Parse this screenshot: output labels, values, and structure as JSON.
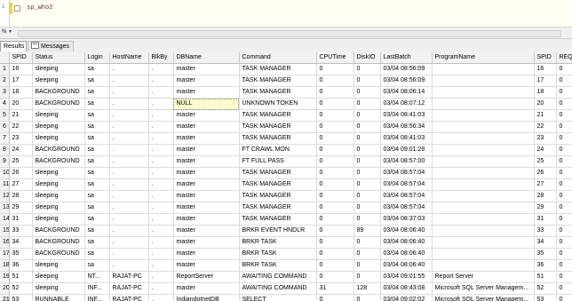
{
  "editor": {
    "line_number": "1",
    "code": "sp_who2"
  },
  "zoom": {
    "value": "%"
  },
  "tabs": [
    {
      "label": "Results"
    },
    {
      "label": "Messages"
    }
  ],
  "grid": {
    "columns": [
      "",
      "SPID",
      "Status",
      "Login",
      "HostName",
      "BlkBy",
      "DBName",
      "Command",
      "CPUTime",
      "DiskIO",
      "LastBatch",
      "ProgramName",
      "SPID",
      "REQ"
    ],
    "rows": [
      [
        "1",
        "16",
        "sleeping",
        "sa",
        ".",
        ".",
        "master",
        "TASK MANAGER",
        "0",
        "0",
        "03/04 08:56:09",
        "",
        "16",
        "0"
      ],
      [
        "2",
        "17",
        "sleeping",
        "sa",
        ".",
        ".",
        "master",
        "TASK MANAGER",
        "0",
        "0",
        "03/04 08:56:09",
        "",
        "17",
        "0"
      ],
      [
        "3",
        "18",
        "BACKGROUND",
        "sa",
        ".",
        ".",
        "master",
        "TASK MANAGER",
        "0",
        "0",
        "03/04 08:06:14",
        "",
        "18",
        "0"
      ],
      [
        "4",
        "20",
        "BACKGROUND",
        "sa",
        ".",
        ".",
        "NULL",
        "UNKNOWN TOKEN",
        "0",
        "0",
        "03/04 08:07:12",
        "",
        "20",
        "0"
      ],
      [
        "5",
        "21",
        "sleeping",
        "sa",
        ".",
        ".",
        "master",
        "TASK MANAGER",
        "0",
        "0",
        "03/04 08:41:03",
        "",
        "21",
        "0"
      ],
      [
        "6",
        "22",
        "sleeping",
        "sa",
        ".",
        ".",
        "master",
        "TASK MANAGER",
        "0",
        "0",
        "03/04 08:56:34",
        "",
        "22",
        "0"
      ],
      [
        "7",
        "23",
        "sleeping",
        "sa",
        ".",
        ".",
        "master",
        "TASK MANAGER",
        "0",
        "0",
        "03/04 08:41:03",
        "",
        "23",
        "0"
      ],
      [
        "8",
        "24",
        "BACKGROUND",
        "sa",
        ".",
        ".",
        "master",
        "FT CRAWL MON",
        "0",
        "0",
        "03/04 09:01:28",
        "",
        "24",
        "0"
      ],
      [
        "9",
        "25",
        "BACKGROUND",
        "sa",
        ".",
        ".",
        "master",
        "FT FULL PASS",
        "0",
        "0",
        "03/04 08:57:00",
        "",
        "25",
        "0"
      ],
      [
        "10",
        "26",
        "sleeping",
        "sa",
        ".",
        ".",
        "master",
        "TASK MANAGER",
        "0",
        "0",
        "03/04 08:57:04",
        "",
        "26",
        "0"
      ],
      [
        "11",
        "27",
        "sleeping",
        "sa",
        ".",
        ".",
        "master",
        "TASK MANAGER",
        "0",
        "0",
        "03/04 08:57:04",
        "",
        "27",
        "0"
      ],
      [
        "12",
        "28",
        "sleeping",
        "sa",
        ".",
        ".",
        "master",
        "TASK MANAGER",
        "0",
        "0",
        "03/04 08:57:04",
        "",
        "28",
        "0"
      ],
      [
        "13",
        "29",
        "sleeping",
        "sa",
        ".",
        ".",
        "master",
        "TASK MANAGER",
        "0",
        "0",
        "03/04 08:57:04",
        "",
        "29",
        "0"
      ],
      [
        "14",
        "31",
        "sleeping",
        "sa",
        ".",
        ".",
        "master",
        "TASK MANAGER",
        "0",
        "0",
        "03/04 08:37:03",
        "",
        "31",
        "0"
      ],
      [
        "15",
        "33",
        "BACKGROUND",
        "sa",
        ".",
        ".",
        "master",
        "BRKR EVENT HNDLR",
        "0",
        "89",
        "03/04 08:06:40",
        "",
        "33",
        "0"
      ],
      [
        "16",
        "34",
        "BACKGROUND",
        "sa",
        ".",
        ".",
        "master",
        "BRKR TASK",
        "0",
        "0",
        "03/04 08:06:40",
        "",
        "34",
        "0"
      ],
      [
        "17",
        "35",
        "BACKGROUND",
        "sa",
        ".",
        ".",
        "master",
        "BRKR TASK",
        "0",
        "0",
        "03/04 08:06:40",
        "",
        "35",
        "0"
      ],
      [
        "18",
        "36",
        "sleeping",
        "sa",
        ".",
        ".",
        "master",
        "BRKR TASK",
        "0",
        "0",
        "03/04 08:06:40",
        "",
        "36",
        "0"
      ],
      [
        "19",
        "51",
        "sleeping",
        "NT...",
        "RAJAT-PC",
        ".",
        "ReportServer",
        "AWAITING COMMAND",
        "0",
        "0",
        "03/04 09:01:55",
        "Report Server",
        "51",
        "0"
      ],
      [
        "20",
        "52",
        "sleeping",
        "INF...",
        "RAJAT-PC",
        ".",
        "master",
        "AWAITING COMMAND",
        "31",
        "128",
        "03/04 08:43:08",
        "Microsoft SQL Server Managem...",
        "52",
        "0"
      ],
      [
        "21",
        "53",
        "RUNNABLE",
        "INF...",
        "RAJAT-PC",
        ".",
        "IndiandotnetDB",
        "SELECT",
        "0",
        "0",
        "03/04 09:02:02",
        "Microsoft SQL Server Managem...",
        "53",
        "0"
      ]
    ],
    "selected_cell": {
      "row": 3,
      "column": 6
    }
  }
}
